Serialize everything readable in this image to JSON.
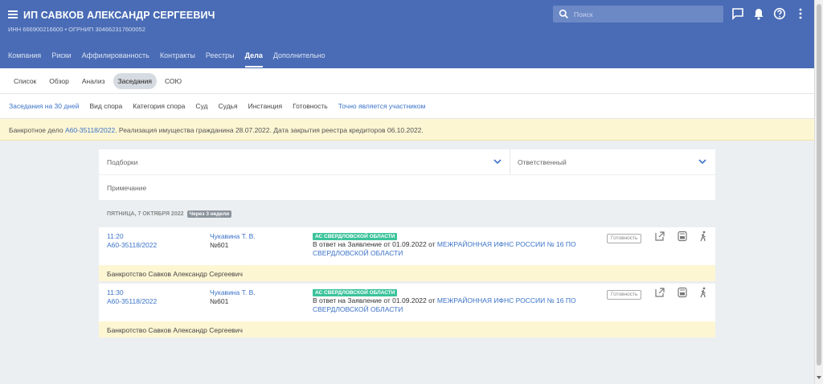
{
  "header": {
    "title": "ИП САВКОВ АЛЕКСАНДР СЕРГЕЕВИЧ",
    "subtitle": "ИНН 666900216600 • ОГРНИП 304662317600052",
    "search_placeholder": "Поиск",
    "icons": [
      "menu-icon",
      "search-icon",
      "chat-icon",
      "bell-icon",
      "help-icon",
      "more-icon"
    ]
  },
  "top_nav": [
    {
      "label": "Компания",
      "active": false
    },
    {
      "label": "Риски",
      "active": false
    },
    {
      "label": "Аффилированность",
      "active": false
    },
    {
      "label": "Контракты",
      "active": false
    },
    {
      "label": "Реестры",
      "active": false
    },
    {
      "label": "Дела",
      "active": true
    },
    {
      "label": "Дополнительно",
      "active": false
    }
  ],
  "sub_tabs": [
    {
      "label": "Список",
      "active": false
    },
    {
      "label": "Обзор",
      "active": false
    },
    {
      "label": "Анализ",
      "active": false
    },
    {
      "label": "Заседания",
      "active": true
    },
    {
      "label": "СОЮ",
      "active": false
    }
  ],
  "filters": [
    {
      "label": "Заседания на 30 дней",
      "highlight": true
    },
    {
      "label": "Вид спора",
      "highlight": false
    },
    {
      "label": "Категория спора",
      "highlight": false
    },
    {
      "label": "Суд",
      "highlight": false
    },
    {
      "label": "Судья",
      "highlight": false
    },
    {
      "label": "Инстанция",
      "highlight": false
    },
    {
      "label": "Готовность",
      "highlight": false
    },
    {
      "label": "Точно является участником",
      "highlight": true
    }
  ],
  "notice": {
    "prefix": "Банкротное дело ",
    "case_link": "А60-35118/2022",
    "suffix": ". Реализация имущества гражданина 28.07.2022. Дата закрытия реестра кредиторов 06.10.2022."
  },
  "selectors": {
    "left": "Подборки",
    "right": "Ответственный",
    "note": "Примечание"
  },
  "date_group": {
    "date": "ПЯТНИЦА, 7 ОКТЯБРЯ 2022",
    "badge": "Через 3 недели"
  },
  "hearings": [
    {
      "time": "11:20",
      "case": "А60-35118/2022",
      "judge": "Чукавина Т. В.",
      "room": "№601",
      "court": "АС СВЕРДЛОВСКОЙ ОБЛАСТИ",
      "desc_prefix": "В ответ на Заявление от 01.09.2022 от ",
      "desc_link": "МЕЖРАЙОННАЯ ИФНС РОССИИ № 16 ПО СВЕРДЛОВСКОЙ ОБЛАСТИ",
      "ready": "Готовность",
      "case_title": "Банкротство Савков Александр Сергеевич"
    },
    {
      "time": "11:30",
      "case": "А60-35118/2022",
      "judge": "Чукавина Т. В.",
      "room": "№601",
      "court": "АС СВЕРДЛОВСКОЙ ОБЛАСТИ",
      "desc_prefix": "В ответ на Заявление от 01.09.2022 от ",
      "desc_link": "МЕЖРАЙОННАЯ ИФНС РОССИИ № 16 ПО СВЕРДЛОВСКОЙ ОБЛАСТИ",
      "ready": "Готовность",
      "case_title": "Банкротство Савков Александр Сергеевич"
    }
  ],
  "colors": {
    "header": "#4a6cb6",
    "link": "#3b73c8",
    "court_badge": "#3cc39b",
    "notice_bg": "#fdf6d3"
  }
}
